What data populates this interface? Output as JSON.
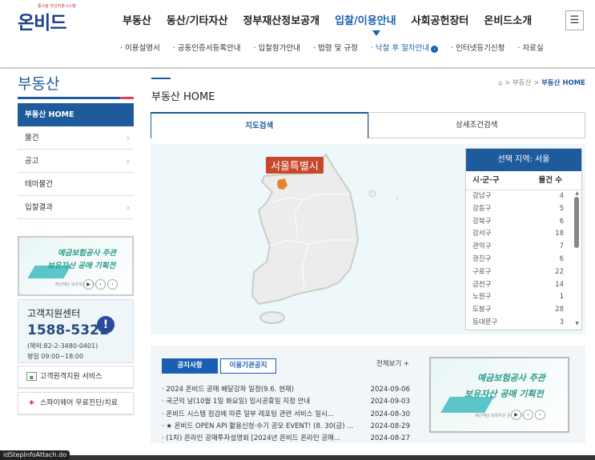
{
  "logo": {
    "sub": "통스탐 자산처분시스템",
    "main": "온비드"
  },
  "gnb": [
    "부동산",
    "동산/기타자산",
    "정부재산정보공개",
    "입찰/이용안내",
    "사회공헌장터",
    "온비드소개"
  ],
  "menu_icon": "hamburger-icon",
  "subnav": [
    "· 이용설명서",
    "· 공동인증서등록안내",
    "· 입찰참가안내",
    "· 법령 및 규정",
    "· 낙찰 후 절차안내",
    "· 인터넷등기신청",
    "· 자료실"
  ],
  "sidebar": {
    "title": "부동산",
    "items": [
      {
        "label": "부동산 HOME",
        "chev": false
      },
      {
        "label": "물건",
        "chev": true
      },
      {
        "label": "공고",
        "chev": true
      },
      {
        "label": "테마물건",
        "chev": false
      },
      {
        "label": "입찰결과",
        "chev": true
      }
    ]
  },
  "banner": {
    "line1": "예금보험공사 주관",
    "line2": "보유자산 공매 기획전",
    "small": "파산재단 보유자산 공매 기획"
  },
  "cs": {
    "title": "고객지원센터",
    "phone": "1588-5321",
    "overseas": "(해외:82-2-3480-0401)",
    "hours": "평일 09:00~18:00"
  },
  "services": [
    "고객원격지원 서비스",
    "스파이웨어 무료진단/치료"
  ],
  "content": {
    "title": "부동산 HOME",
    "breadcrumb": [
      "부동산",
      "부동산 HOME"
    ]
  },
  "tabs": [
    "지도검색",
    "상세조건검색"
  ],
  "map": {
    "selected_label": "서울특별시",
    "highlight_color": "#e8822e"
  },
  "region": {
    "header": "선택 지역: 서울",
    "col1": "시·군·구",
    "col2": "물건 수",
    "rows": [
      [
        "강남구",
        "4"
      ],
      [
        "강동구",
        "5"
      ],
      [
        "강북구",
        "6"
      ],
      [
        "강서구",
        "18"
      ],
      [
        "관악구",
        "7"
      ],
      [
        "광진구",
        "6"
      ],
      [
        "구로구",
        "22"
      ],
      [
        "금천구",
        "14"
      ],
      [
        "노원구",
        "1"
      ],
      [
        "도봉구",
        "28"
      ],
      [
        "동대문구",
        "3"
      ]
    ]
  },
  "notice": {
    "tab1": "공지사항",
    "tab2": "이용기관공지",
    "more": "전체보기 +",
    "items": [
      [
        "· 2024 온비드 공매 배달강좌 일정(9.6. 현재)",
        "2024-09-06"
      ],
      [
        "· 국군의 날(10월 1일 화요일) 임시공휴일 지정 안내",
        "2024-09-03"
      ],
      [
        "· 온비드 시스템 점검에 따른 일부 레포팅 관련 서비스 일시...",
        "2024-08-30"
      ],
      [
        "· ★ 온비드 OPEN API 활용신청·수기 공모 EVENT! (8. 30(금) ...",
        "2024-08-29"
      ],
      [
        "· (1차) 온라인 공매투자설명회 [2024년 온비드 온라인 공매...",
        "2024-08-27"
      ]
    ]
  },
  "status": "idStepInfoAttach.do"
}
